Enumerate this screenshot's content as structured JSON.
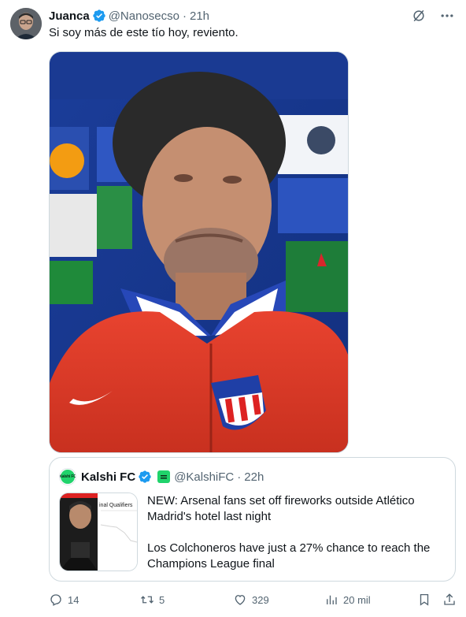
{
  "tweet": {
    "author_name": "Juanca",
    "author_handle": "@Nanosecso",
    "separator": "·",
    "time": "21h",
    "text": "Si soy más de este tío hoy, reviento."
  },
  "quoted_tweet": {
    "author_name": "Kalshi FC",
    "avatar_text": "Kalshi FC",
    "author_handle": "@KalshiFC",
    "separator": "·",
    "time": "22h",
    "paragraphs": [
      "NEW: Arsenal fans set off fireworks outside Atlético Madrid's hotel last night",
      "Los Colchoneros have just a 27% chance to reach the Champions League final"
    ],
    "media_caption": "inal Qualifiers"
  },
  "actions": {
    "replies": "14",
    "retweets": "5",
    "likes": "329",
    "views": "20 mil"
  },
  "icons": {
    "header": [
      "verified-badge-icon",
      "grok-icon",
      "more-icon"
    ],
    "actions": [
      "reply-icon",
      "retweet-icon",
      "like-icon",
      "views-icon",
      "bookmark-icon",
      "share-icon"
    ]
  },
  "colors": {
    "verified": "#1d9bf0",
    "secondary_text": "#536471",
    "border": "#cfd9de",
    "kalshi_green": "#20d36b"
  }
}
